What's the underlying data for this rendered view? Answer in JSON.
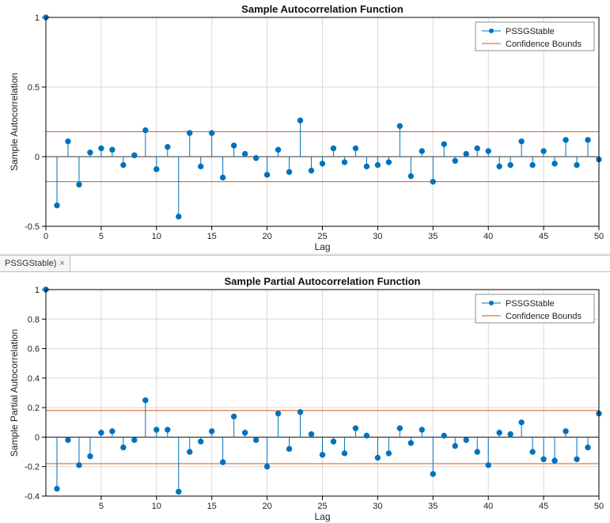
{
  "chart_data": [
    {
      "type": "stem",
      "title": "Sample Autocorrelation Function",
      "xlabel": "Lag",
      "ylabel": "Sample Autocorrelation",
      "xlim": [
        0,
        50
      ],
      "ylim": [
        -0.5,
        1.0
      ],
      "xticks": [
        0,
        5,
        10,
        15,
        20,
        25,
        30,
        35,
        40,
        45,
        50
      ],
      "yticks": [
        -0.5,
        0,
        0.5,
        1.0
      ],
      "series_name": "PSSGStable",
      "confidence_name": "Confidence Bounds",
      "confidence_upper": 0.18,
      "confidence_lower": -0.18,
      "x": [
        0,
        1,
        2,
        3,
        4,
        5,
        6,
        7,
        8,
        9,
        10,
        11,
        12,
        13,
        14,
        15,
        16,
        17,
        18,
        19,
        20,
        21,
        22,
        23,
        24,
        25,
        26,
        27,
        28,
        29,
        30,
        31,
        32,
        33,
        34,
        35,
        36,
        37,
        38,
        39,
        40,
        41,
        42,
        43,
        44,
        45,
        46,
        47,
        48,
        49,
        50
      ],
      "values": [
        1.0,
        -0.35,
        0.11,
        -0.2,
        0.03,
        0.06,
        0.05,
        -0.06,
        0.01,
        0.19,
        -0.09,
        0.07,
        -0.43,
        0.17,
        -0.07,
        0.17,
        -0.15,
        0.08,
        0.02,
        -0.01,
        -0.13,
        0.05,
        -0.11,
        0.26,
        -0.1,
        -0.05,
        0.06,
        -0.04,
        0.06,
        -0.07,
        -0.06,
        -0.04,
        0.22,
        -0.14,
        0.04,
        -0.18,
        0.09,
        -0.03,
        0.02,
        0.06,
        0.04,
        -0.07,
        -0.06,
        0.11,
        -0.06,
        0.04,
        -0.05,
        0.12,
        -0.06,
        0.12,
        -0.02
      ]
    },
    {
      "type": "stem",
      "title": "Sample Partial Autocorrelation Function",
      "xlabel": "Lag",
      "ylabel": "Sample Partial Autocorrelation",
      "xlim": [
        0,
        50
      ],
      "ylim": [
        -0.4,
        1.0
      ],
      "xticks": [
        5,
        10,
        15,
        20,
        25,
        30,
        35,
        40,
        45,
        50
      ],
      "yticks": [
        -0.4,
        -0.2,
        0,
        0.2,
        0.4,
        0.6,
        0.8,
        1.0
      ],
      "series_name": "PSSGStable",
      "confidence_name": "Confidence Bounds",
      "confidence_upper": 0.18,
      "confidence_lower": -0.18,
      "x": [
        0,
        1,
        2,
        3,
        4,
        5,
        6,
        7,
        8,
        9,
        10,
        11,
        12,
        13,
        14,
        15,
        16,
        17,
        18,
        19,
        20,
        21,
        22,
        23,
        24,
        25,
        26,
        27,
        28,
        29,
        30,
        31,
        32,
        33,
        34,
        35,
        36,
        37,
        38,
        39,
        40,
        41,
        42,
        43,
        44,
        45,
        46,
        47,
        48,
        49,
        50
      ],
      "values": [
        1.0,
        -0.35,
        -0.02,
        -0.19,
        -0.13,
        0.03,
        0.04,
        -0.07,
        -0.02,
        0.25,
        0.05,
        0.05,
        -0.37,
        -0.1,
        -0.03,
        0.04,
        -0.17,
        0.14,
        0.03,
        -0.02,
        -0.2,
        0.16,
        -0.08,
        0.17,
        0.02,
        -0.12,
        -0.03,
        -0.11,
        0.06,
        0.01,
        -0.14,
        -0.11,
        0.06,
        -0.04,
        0.05,
        -0.25,
        0.01,
        -0.06,
        -0.02,
        -0.1,
        -0.19,
        0.03,
        0.02,
        0.1,
        -0.1,
        -0.15,
        -0.16,
        0.04,
        -0.15,
        -0.07,
        0.16
      ]
    }
  ],
  "tab": {
    "label": "PSSGStable)",
    "close_glyph": "×"
  },
  "legend": {
    "items": [
      "PSSGStable",
      "Confidence Bounds"
    ]
  },
  "colors": {
    "series": "#0072bd",
    "confidence": "#d95319",
    "grid": "#d9d9d9"
  }
}
